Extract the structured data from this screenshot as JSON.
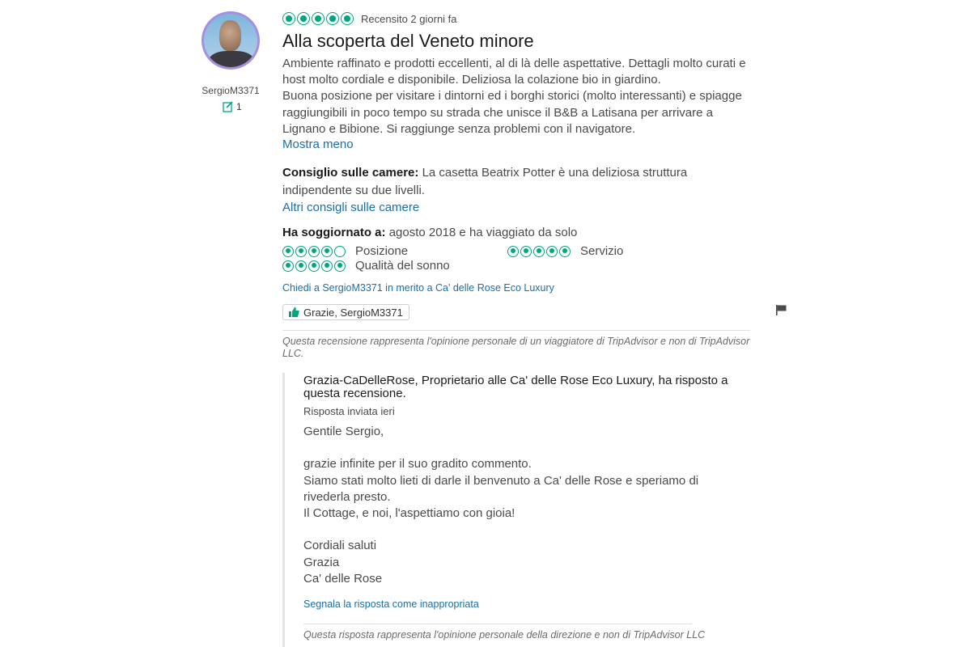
{
  "reviewer": {
    "username": "SergioM3371",
    "contributions": "1"
  },
  "review": {
    "rating": 5,
    "date": "Recensito 2 giorni fa",
    "title": "Alla scoperta del Veneto minore",
    "body_lines": [
      "Ambiente raffinato e prodotti eccellenti, al di là delle aspettative. Dettagli molto curati e host molto cordiale e disponibile. Deliziosa la colazione bio in giardino.",
      "Buona posizione per visitare i dintorni ed i borghi storici (molto interessanti) e spiagge raggiungibili in poco tempo su strada che unisce il B&B a Latisana per arrivare a Lignano e Bibione. Si raggiunge senza problemi con il navigatore."
    ],
    "show_less": "Mostra meno",
    "room_tip_label": "Consiglio sulle camere:",
    "room_tip_text": "La casetta Beatrix Potter è una deliziosa struttura indipendente su due livelli.",
    "more_room_tips": "Altri consigli sulle camere",
    "stayed_label": "Ha soggiornato a:",
    "stayed_text": "agosto 2018 e ha viaggiato da solo",
    "sub_ratings": [
      {
        "label": "Posizione",
        "rating": 4
      },
      {
        "label": "Servizio",
        "rating": 5
      },
      {
        "label": "Qualità del sonno",
        "rating": 5
      }
    ],
    "ask_link": "Chiedi a SergioM3371 in merito a Ca' delle Rose Eco Luxury",
    "thanks_button": "Grazie, SergioM3371",
    "disclaimer": "Questa recensione rappresenta l'opinione personale di un viaggiatore di TripAdvisor e non di TripAdvisor LLC."
  },
  "response": {
    "header": "Grazia-CaDelleRose, Proprietario alle Ca' delle Rose Eco Luxury, ha risposto a questa recensione.",
    "date": "Risposta inviata ieri",
    "lines": [
      "Gentile Sergio,",
      "",
      "grazie infinite per il suo gradito commento.",
      "Siamo stati molto lieti di darle il benvenuto a Ca' delle Rose e speriamo di rivederla presto.",
      "Il Cottage, e noi, l'aspettiamo con gioia!",
      "",
      "Cordiali saluti",
      "Grazia",
      "Ca' delle Rose"
    ],
    "report_link": "Segnala la risposta come inappropriata",
    "disclaimer": "Questa risposta rappresenta l'opinione personale della direzione e non di TripAdvisor LLC"
  },
  "colors": {
    "bubble": "#00a680",
    "link": "#1b6fa9",
    "avatar_ring": "#a68fe0"
  },
  "icons": [
    "contribution-icon",
    "thumbs-up-icon",
    "flag-icon",
    "rating-bubble-icon"
  ]
}
